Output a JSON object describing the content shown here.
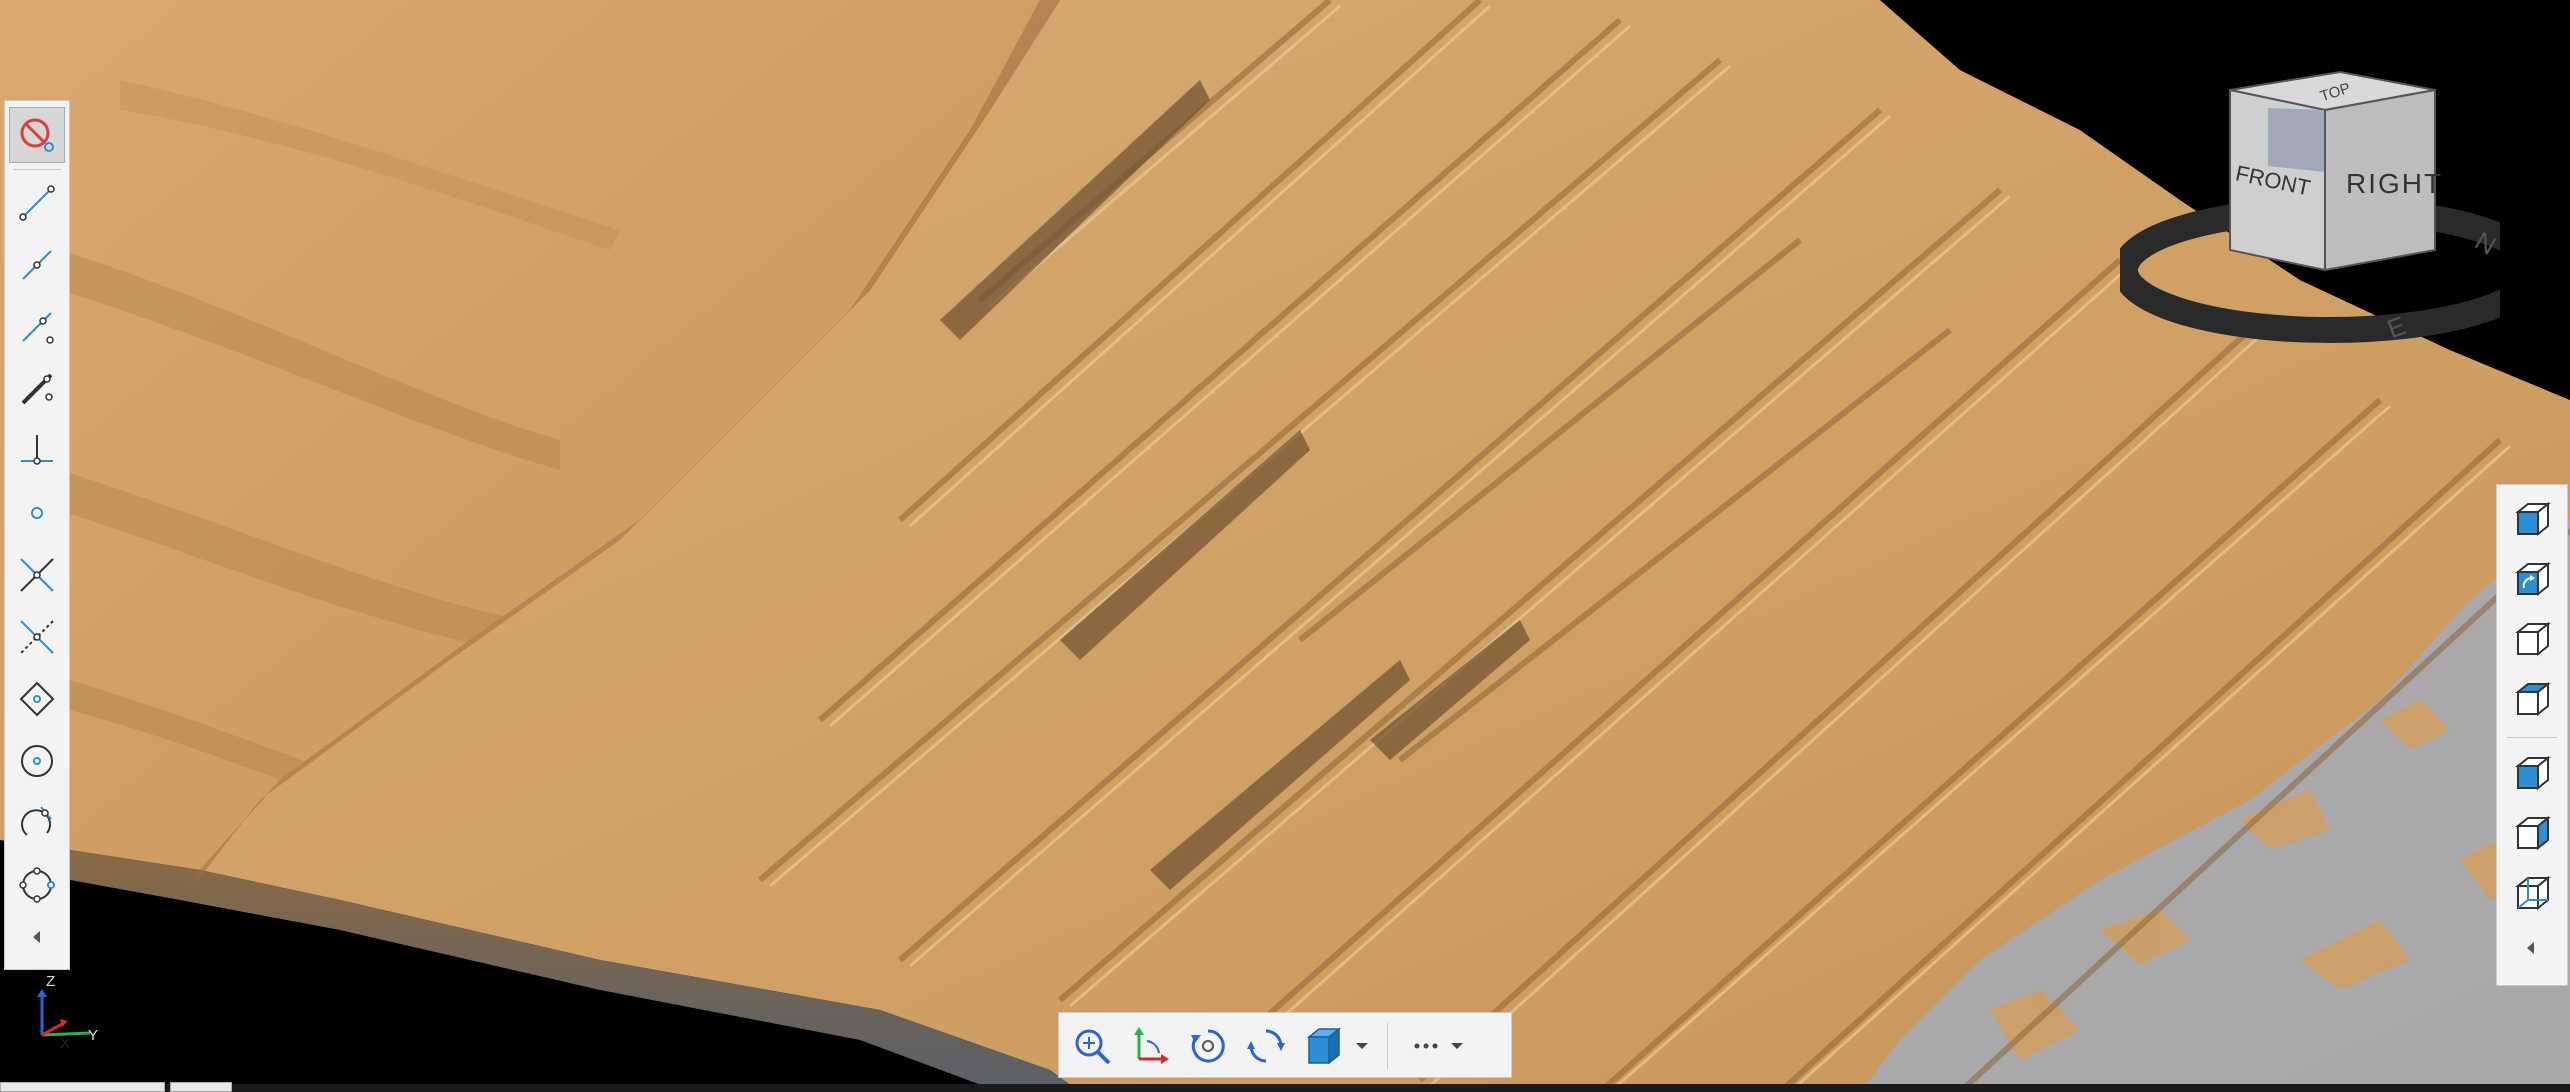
{
  "view_cube": {
    "front_label": "FRONT",
    "right_label": "RIGHT",
    "top_label": "TOP",
    "compass_n": "N",
    "compass_e": "E"
  },
  "axis_triad": {
    "z_label": "Z",
    "y_label": "Y",
    "x_label": "X"
  },
  "snap_toolbar": {
    "items": [
      {
        "name": "snap-off-icon",
        "active": true
      },
      {
        "name": "snap-endpoint-icon"
      },
      {
        "name": "snap-midpoint-icon"
      },
      {
        "name": "snap-nearest-icon"
      },
      {
        "name": "snap-node-icon"
      },
      {
        "name": "snap-perpendicular-icon"
      },
      {
        "name": "snap-center-icon"
      },
      {
        "name": "snap-intersection-icon"
      },
      {
        "name": "snap-apparent-intersection-icon"
      },
      {
        "name": "snap-quadrant-icon"
      },
      {
        "name": "snap-tangent-icon"
      },
      {
        "name": "snap-arc-tangent-icon"
      },
      {
        "name": "snap-circle-quadrant-icon"
      }
    ]
  },
  "view_toolbar": {
    "items": [
      "view-iso-front-icon",
      "view-rotate-icon",
      "view-wireframe-icon",
      "view-shaded-icon",
      "view-top-icon",
      "view-side-icon",
      "view-back-icon"
    ]
  },
  "nav_toolbar": {
    "items": [
      "zoom-extents-icon",
      "ucs-axes-icon",
      "orbit-icon",
      "free-orbit-icon",
      "visual-style-icon",
      "visual-style-dropdown-icon",
      "more-options-icon"
    ]
  },
  "colors": {
    "terrain": "#d4a66e",
    "terrain_shadow": "#8a6436",
    "terrain_light": "#e8c796",
    "rock_gray": "#9fa6b4",
    "background": "#000000",
    "toolbar_bg": "#f3f3f3",
    "accent_blue": "#2a8fd6",
    "snap_red": "#d8403b"
  }
}
